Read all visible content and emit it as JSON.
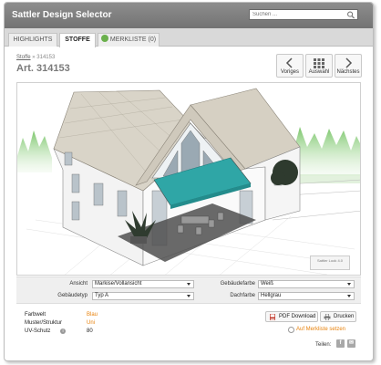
{
  "app": {
    "title": "Sattler Design Selector"
  },
  "search": {
    "placeholder": "Suchen ..."
  },
  "tabs": [
    {
      "label": "HIGHLIGHTS"
    },
    {
      "label": "STOFFE"
    },
    {
      "label": "MERKLISTE (0)"
    }
  ],
  "breadcrumb": {
    "link": "Stoffe",
    "separator": "»",
    "current": "314153"
  },
  "article": {
    "title": "Art. 314153"
  },
  "nav": {
    "prev": "Voriges",
    "all": "Auswahl",
    "next": "Nächstes"
  },
  "viewer": {
    "badge": "Sattler Look 4.0"
  },
  "options": {
    "ansicht": {
      "label": "Ansicht",
      "value": "Markise/Vollansicht"
    },
    "gebaeudetyp": {
      "label": "Gebäudetyp",
      "value": "Typ A"
    },
    "gebaeudefarbe": {
      "label": "Gebäudefarbe",
      "value": "Weiß"
    },
    "dachfarbe": {
      "label": "Dachfarbe",
      "value": "Hellgrau"
    }
  },
  "properties": [
    {
      "key": "Farbwelt",
      "value": "Blau"
    },
    {
      "key": "Muster/Struktur",
      "value": "Uni"
    },
    {
      "key": "UV-Schutz",
      "value": "80"
    }
  ],
  "actions": {
    "pdf": "PDF Download",
    "print": "Drucken",
    "merkliste": "Auf Merkliste setzen"
  },
  "share": {
    "label": "Teilen:"
  },
  "colors": {
    "awning": "#2fa6a6",
    "accent": "#e8820c",
    "titlebar": "#808080"
  }
}
